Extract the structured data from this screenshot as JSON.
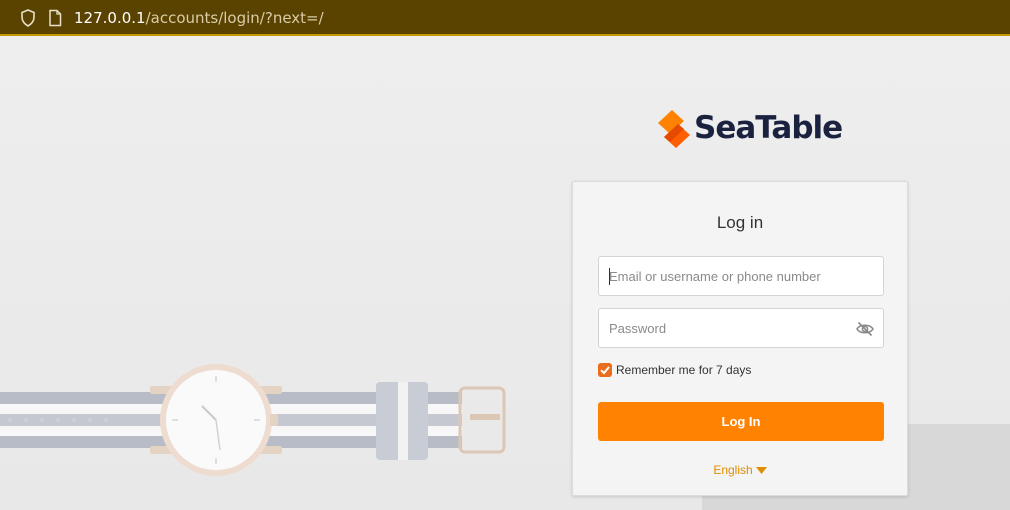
{
  "browser": {
    "url_host": "127.0.0.1",
    "url_path": "/accounts/login/?next=/",
    "bar_color": "#5a4200"
  },
  "brand": {
    "name": "SeaTable",
    "logo_color": "#1b2240",
    "accent": "#ff8200"
  },
  "login": {
    "title": "Log in",
    "email_placeholder": "Email or username or phone number",
    "email_value": "",
    "password_placeholder": "Password",
    "password_value": "",
    "remember_label": "Remember me for 7 days",
    "remember_checked": true,
    "submit_label": "Log In",
    "language": "English"
  },
  "icons": {
    "url_bar": [
      "shield-icon",
      "page-icon"
    ],
    "password": "eye-off-icon",
    "language": "caret-down-icon"
  }
}
